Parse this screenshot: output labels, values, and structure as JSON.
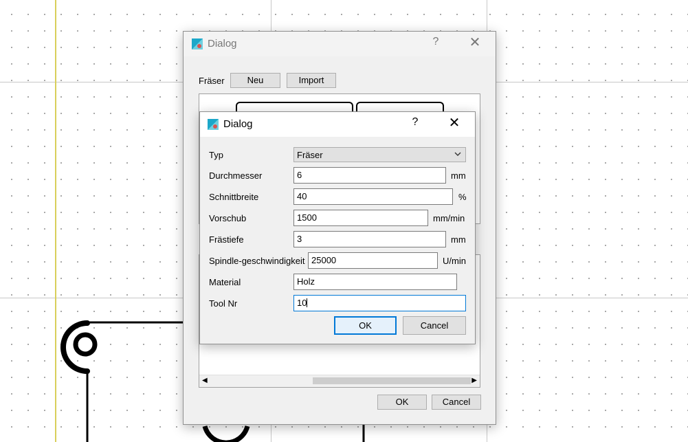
{
  "outer_dialog": {
    "title": "Dialog",
    "help": "?",
    "close": "✕",
    "fraser_label": "Fräser",
    "new_button": "Neu",
    "import_button": "Import",
    "ok_button": "OK",
    "cancel_button": "Cancel",
    "scroll_left": "◀",
    "scroll_right": "▶"
  },
  "inner_dialog": {
    "title": "Dialog",
    "help": "?",
    "close": "✕",
    "type_label": "Typ",
    "type_value": "Fräser",
    "fields": {
      "durchmesser": {
        "label": "Durchmesser",
        "value": "6",
        "unit": "mm"
      },
      "schnittbreite": {
        "label": "Schnittbreite",
        "value": "40",
        "unit": "%"
      },
      "vorschub": {
        "label": "Vorschub",
        "value": "1500",
        "unit": "mm/min"
      },
      "frastiefe": {
        "label": "Frästiefe",
        "value": "3",
        "unit": "mm"
      },
      "spindle": {
        "label": "Spindle-geschwindigkeit",
        "value": "25000",
        "unit": "U/min"
      },
      "material": {
        "label": "Material",
        "value": "Holz"
      },
      "tool_nr": {
        "label": "Tool Nr",
        "value": "10"
      }
    },
    "ok_button": "OK",
    "cancel_button": "Cancel"
  },
  "colors": {
    "accent": "#0078d7",
    "canvas_track": "#000000"
  },
  "icons": {
    "app": "app-logo-icon",
    "dropdown": "chevron-down-icon"
  }
}
